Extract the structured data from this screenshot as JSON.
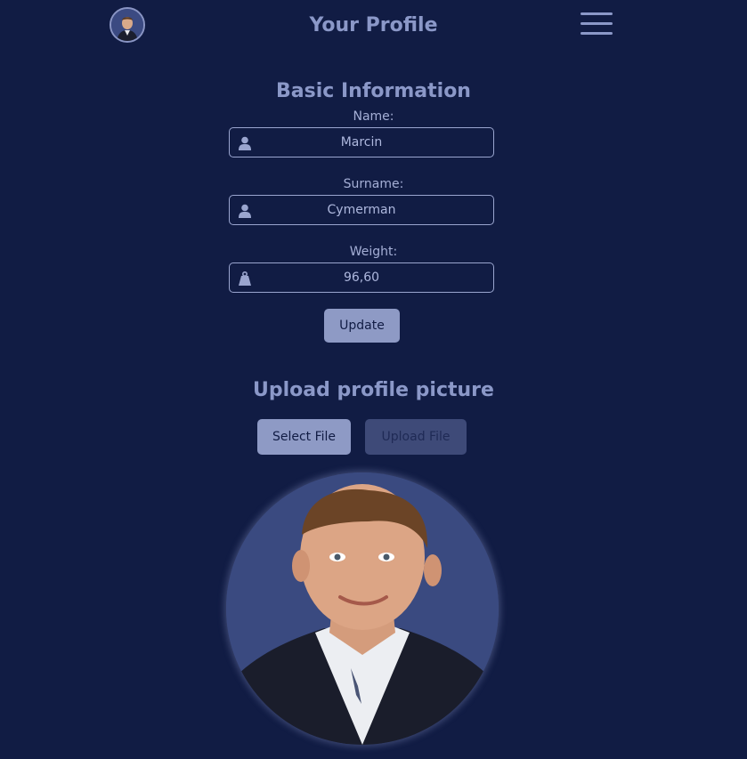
{
  "header": {
    "title": "Your Profile"
  },
  "basic_info": {
    "title": "Basic Information",
    "name_label": "Name:",
    "name_value": "Marcin",
    "surname_label": "Surname:",
    "surname_value": "Cymerman",
    "weight_label": "Weight:",
    "weight_value": "96,60",
    "update_label": "Update"
  },
  "upload": {
    "title": "Upload profile picture",
    "select_label": "Select File",
    "upload_label": "Upload File"
  },
  "colors": {
    "background": "#111c44",
    "accent": "#8e9ac5",
    "disabled": "#3e4a78"
  },
  "icons": {
    "name_field": "user-icon",
    "surname_field": "user-icon",
    "weight_field": "weight-icon",
    "menu": "hamburger-menu-icon"
  }
}
